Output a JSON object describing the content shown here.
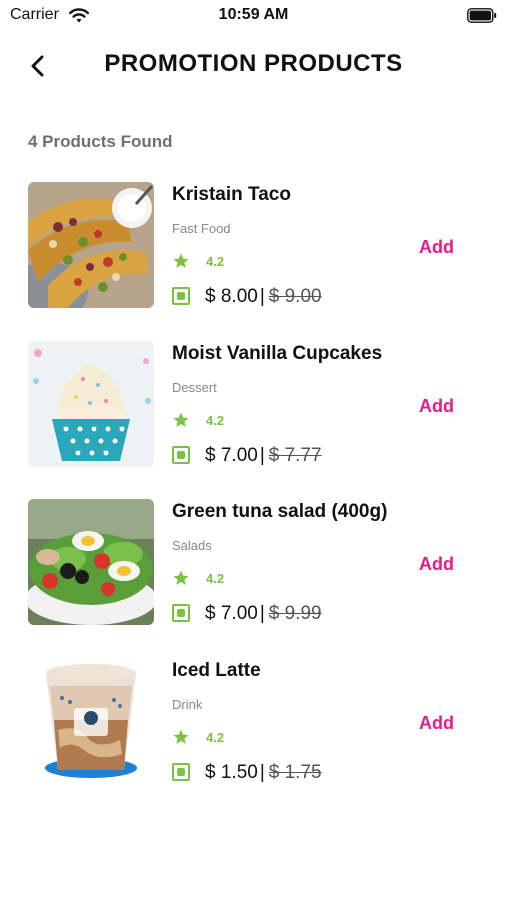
{
  "status_bar": {
    "carrier": "Carrier",
    "time": "10:59 AM"
  },
  "header": {
    "title": "PROMOTION PRODUCTS",
    "back_icon": "chevron-left-icon"
  },
  "results_count": "4 Products Found",
  "colors": {
    "accent_add": "#e8198b",
    "rating_green": "#7cc242",
    "veg_green": "#7cc242"
  },
  "products": [
    {
      "name": "Kristain Taco",
      "category": "Fast Food",
      "rating": "4.2",
      "price": "$ 8.00",
      "old_price": "$ 9.00",
      "add_label": "Add"
    },
    {
      "name": "Moist Vanilla Cupcakes",
      "category": "Dessert",
      "rating": "4.2",
      "price": "$ 7.00",
      "old_price": "$ 7.77",
      "add_label": "Add"
    },
    {
      "name": "Green tuna salad (400g)",
      "category": "Salads",
      "rating": "4.2",
      "price": "$ 7.00",
      "old_price": "$ 9.99",
      "add_label": "Add"
    },
    {
      "name": "Iced Latte",
      "category": "Drink",
      "rating": "4.2",
      "price": "$ 1.50",
      "old_price": "$ 1.75",
      "add_label": "Add"
    }
  ]
}
